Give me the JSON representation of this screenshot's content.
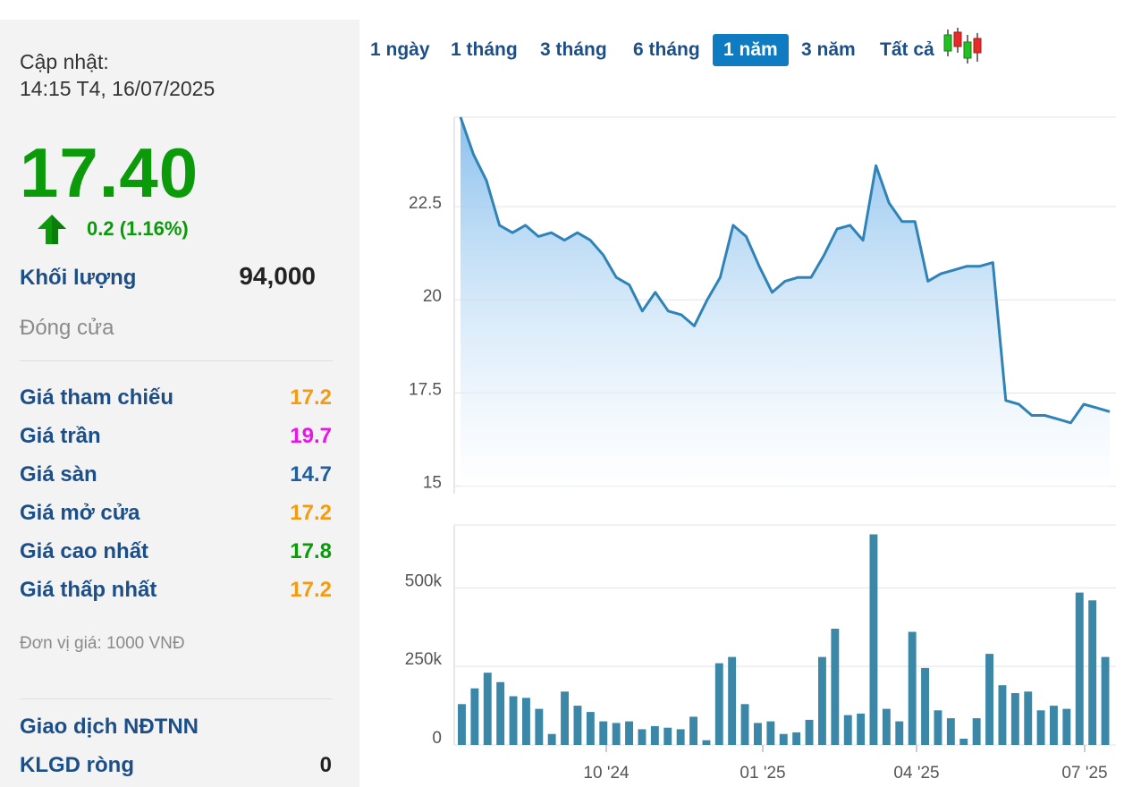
{
  "sidebar": {
    "updated_label": "Cập nhật:",
    "updated_time": "14:15 T4, 16/07/2025",
    "price": "17.40",
    "change": "0.2 (1.16%)",
    "volume_label": "Khối lượng",
    "volume_value": "94,000",
    "status": "Đóng cửa",
    "rows": [
      {
        "label": "Giá tham chiếu",
        "value": "17.2",
        "color": "#f39c12"
      },
      {
        "label": "Giá trần",
        "value": "19.7",
        "color": "#e815e8"
      },
      {
        "label": "Giá sàn",
        "value": "14.7",
        "color": "#1f5f9e"
      },
      {
        "label": "Giá mở cửa",
        "value": "17.2",
        "color": "#f39c12"
      },
      {
        "label": "Giá cao nhất",
        "value": "17.8",
        "color": "#0a9a0a"
      },
      {
        "label": "Giá thấp nhất",
        "value": "17.2",
        "color": "#f39c12"
      }
    ],
    "unit_note": "Đơn vị giá: 1000 VNĐ",
    "foreign_title": "Giao dịch NĐTNN",
    "net_label": "KLGD ròng",
    "net_value": "0"
  },
  "tabs": [
    "1 ngày",
    "1 tháng",
    "3 tháng",
    "6 tháng",
    "1 năm",
    "3 năm",
    "Tất cả"
  ],
  "active_tab": "1 năm",
  "colors": {
    "line": "#2f83b7",
    "fill_top": "#8ec3ee",
    "bar": "#3a87a8",
    "up": "#0a9a0a"
  },
  "chart_data": [
    {
      "type": "area",
      "name": "price",
      "x_ticks": [
        "10 '24",
        "01 '25",
        "04 '25",
        "07 '25"
      ],
      "y_ticks": [
        15,
        17.5,
        20,
        22.5
      ],
      "ylim": [
        14.8,
        24.9
      ],
      "values": [
        24.9,
        23.9,
        23.2,
        22.0,
        21.8,
        22.0,
        21.7,
        21.8,
        21.6,
        21.8,
        21.6,
        21.2,
        20.6,
        20.4,
        19.7,
        20.2,
        19.7,
        19.6,
        19.3,
        20.0,
        20.6,
        22.0,
        21.7,
        20.9,
        20.2,
        20.5,
        20.6,
        20.6,
        21.2,
        21.9,
        22.0,
        21.6,
        23.6,
        22.6,
        22.1,
        22.1,
        20.5,
        20.7,
        20.8,
        20.9,
        20.9,
        21.0,
        17.3,
        17.2,
        16.9,
        16.9,
        16.8,
        16.7,
        17.2,
        17.1,
        17.0
      ],
      "grid": true
    },
    {
      "type": "bar",
      "name": "volume",
      "y_ticks": [
        "0",
        "250k",
        "500k"
      ],
      "ylim": [
        0,
        700000
      ],
      "values": [
        130000,
        180000,
        230000,
        200000,
        155000,
        150000,
        115000,
        35000,
        170000,
        125000,
        105000,
        75000,
        70000,
        75000,
        50000,
        60000,
        55000,
        50000,
        90000,
        15000,
        260000,
        280000,
        130000,
        70000,
        75000,
        35000,
        40000,
        80000,
        280000,
        370000,
        95000,
        100000,
        670000,
        115000,
        75000,
        360000,
        245000,
        110000,
        85000,
        20000,
        85000,
        290000,
        190000,
        165000,
        170000,
        110000,
        125000,
        115000,
        485000,
        460000,
        280000
      ],
      "grid": true
    }
  ]
}
